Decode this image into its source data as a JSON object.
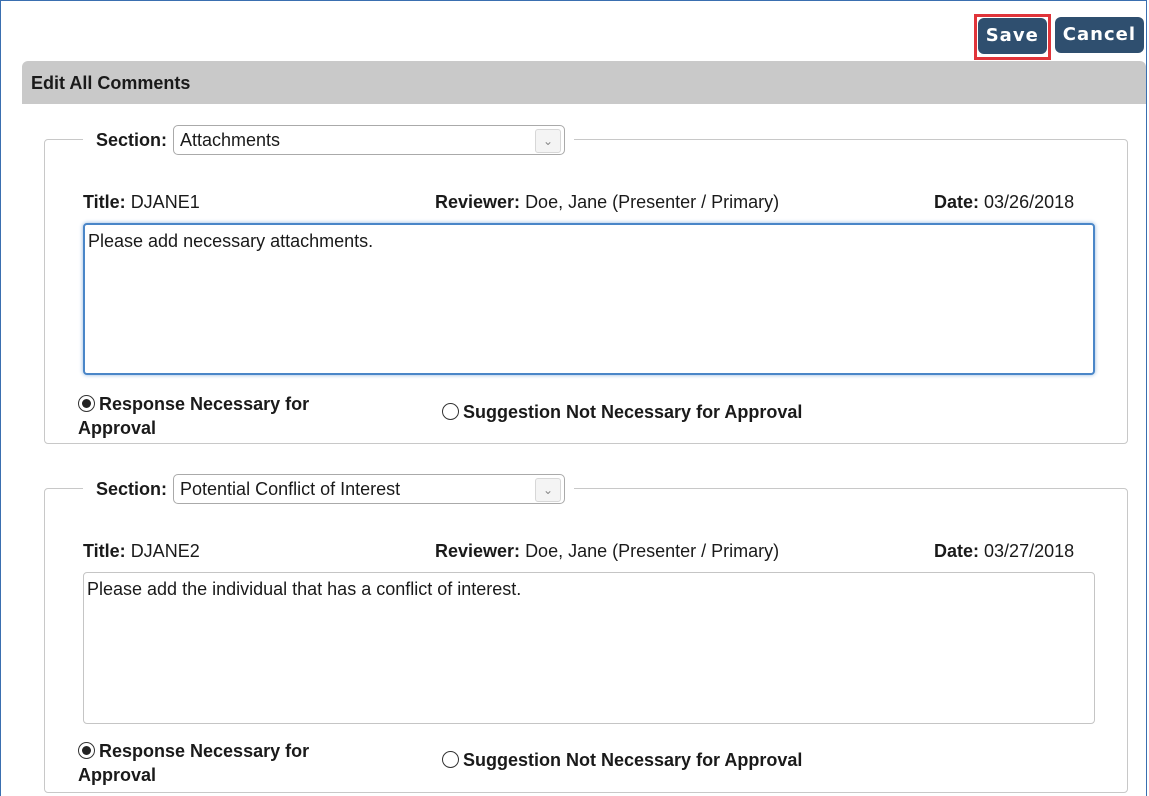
{
  "toolbar": {
    "save_label": "Save",
    "cancel_label": "Cancel"
  },
  "panel": {
    "title": "Edit All Comments"
  },
  "labels": {
    "section": "Section:",
    "title": "Title:",
    "reviewer": "Reviewer:",
    "date": "Date:",
    "option_required": "Response Necessary for",
    "option_required_2": "Approval",
    "option_suggestion": "Suggestion Not Necessary for Approval"
  },
  "comments": [
    {
      "section": "Attachments",
      "title": "DJANE1",
      "reviewer": "Doe, Jane (Presenter / Primary)",
      "date": "03/26/2018",
      "text": "Please add necessary attachments.",
      "selected_option": "Response Necessary for Approval"
    },
    {
      "section": "Potential Conflict of Interest",
      "title": "DJANE2",
      "reviewer": "Doe, Jane (Presenter / Primary)",
      "date": "03/27/2018",
      "text": "Please add the individual that has a conflict of interest.",
      "selected_option": "Response Necessary for Approval"
    }
  ]
}
